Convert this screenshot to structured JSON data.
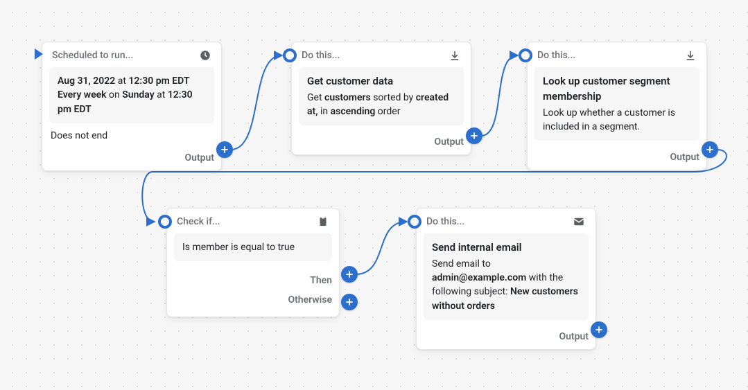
{
  "cards": {
    "schedule": {
      "header": "Scheduled to run...",
      "date": "Aug 31, 2022",
      "at1": " at ",
      "time1": "12:30 pm EDT",
      "every": "Every week",
      "on": " on ",
      "day": "Sunday",
      "at2": " at ",
      "time2": "12:30 pm EDT",
      "noend": "Does not end",
      "output": "Output"
    },
    "getdata": {
      "header": "Do this...",
      "title": "Get customer data",
      "p1a": "Get ",
      "p1b": "customers",
      "p1c": " sorted by ",
      "p1d": "created at,",
      "p1e": " in ",
      "p1f": "ascending",
      "p1g": " order",
      "output": "Output"
    },
    "lookup": {
      "header": "Do this...",
      "title": "Look up customer segment membership",
      "desc": "Look up whether a customer is included in a segment.",
      "output": "Output"
    },
    "checkif": {
      "header": "Check if...",
      "cond": "Is member is equal to true",
      "then": "Then",
      "otherwise": "Otherwise"
    },
    "email": {
      "header": "Do this...",
      "title": "Send internal email",
      "p1": "Send email to ",
      "addr": "admin@example.com",
      "p2": " with the following subject: ",
      "subj": "New customers without orders",
      "output": "Output"
    }
  }
}
